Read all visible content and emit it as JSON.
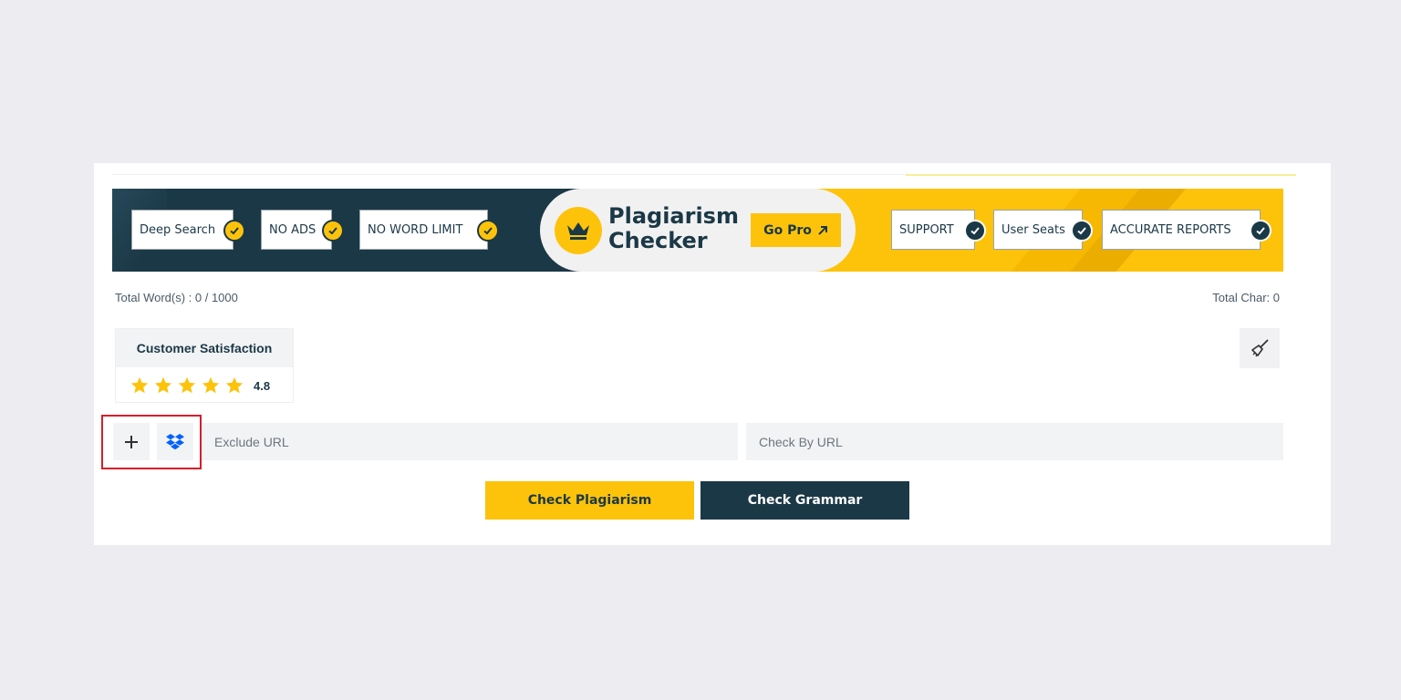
{
  "banner": {
    "features_left": [
      {
        "label": "Deep Search"
      },
      {
        "label": "NO ADS"
      },
      {
        "label": "NO WORD LIMIT"
      }
    ],
    "brand_line1": "Plagiarism",
    "brand_line2": "Checker",
    "go_pro_label": "Go Pro",
    "features_right": [
      {
        "label": "SUPPORT"
      },
      {
        "label": "User Seats"
      },
      {
        "label": "ACCURATE REPORTS"
      }
    ]
  },
  "stats": {
    "total_words": "Total Word(s) : 0 / 1000",
    "total_chars": "Total Char: 0"
  },
  "satisfaction": {
    "title": "Customer Satisfaction",
    "rating_value": 4.8,
    "rating_text": "4.8",
    "stars": 5
  },
  "inputs": {
    "exclude_url_placeholder": "Exclude URL",
    "check_url_placeholder": "Check By URL"
  },
  "actions": {
    "check_plagiarism": "Check Plagiarism",
    "check_grammar": "Check Grammar"
  },
  "colors": {
    "brand_yellow": "#fdc30b",
    "brand_dark": "#1b3846",
    "highlight_red": "#d41f2a",
    "dropbox_blue": "#0061fe"
  },
  "icons": {
    "crown": "crown-icon",
    "arrow": "arrow-up-right-icon",
    "check": "check-icon",
    "star": "star-icon",
    "broom": "broom-icon",
    "plus": "plus-icon",
    "dropbox": "dropbox-icon"
  }
}
